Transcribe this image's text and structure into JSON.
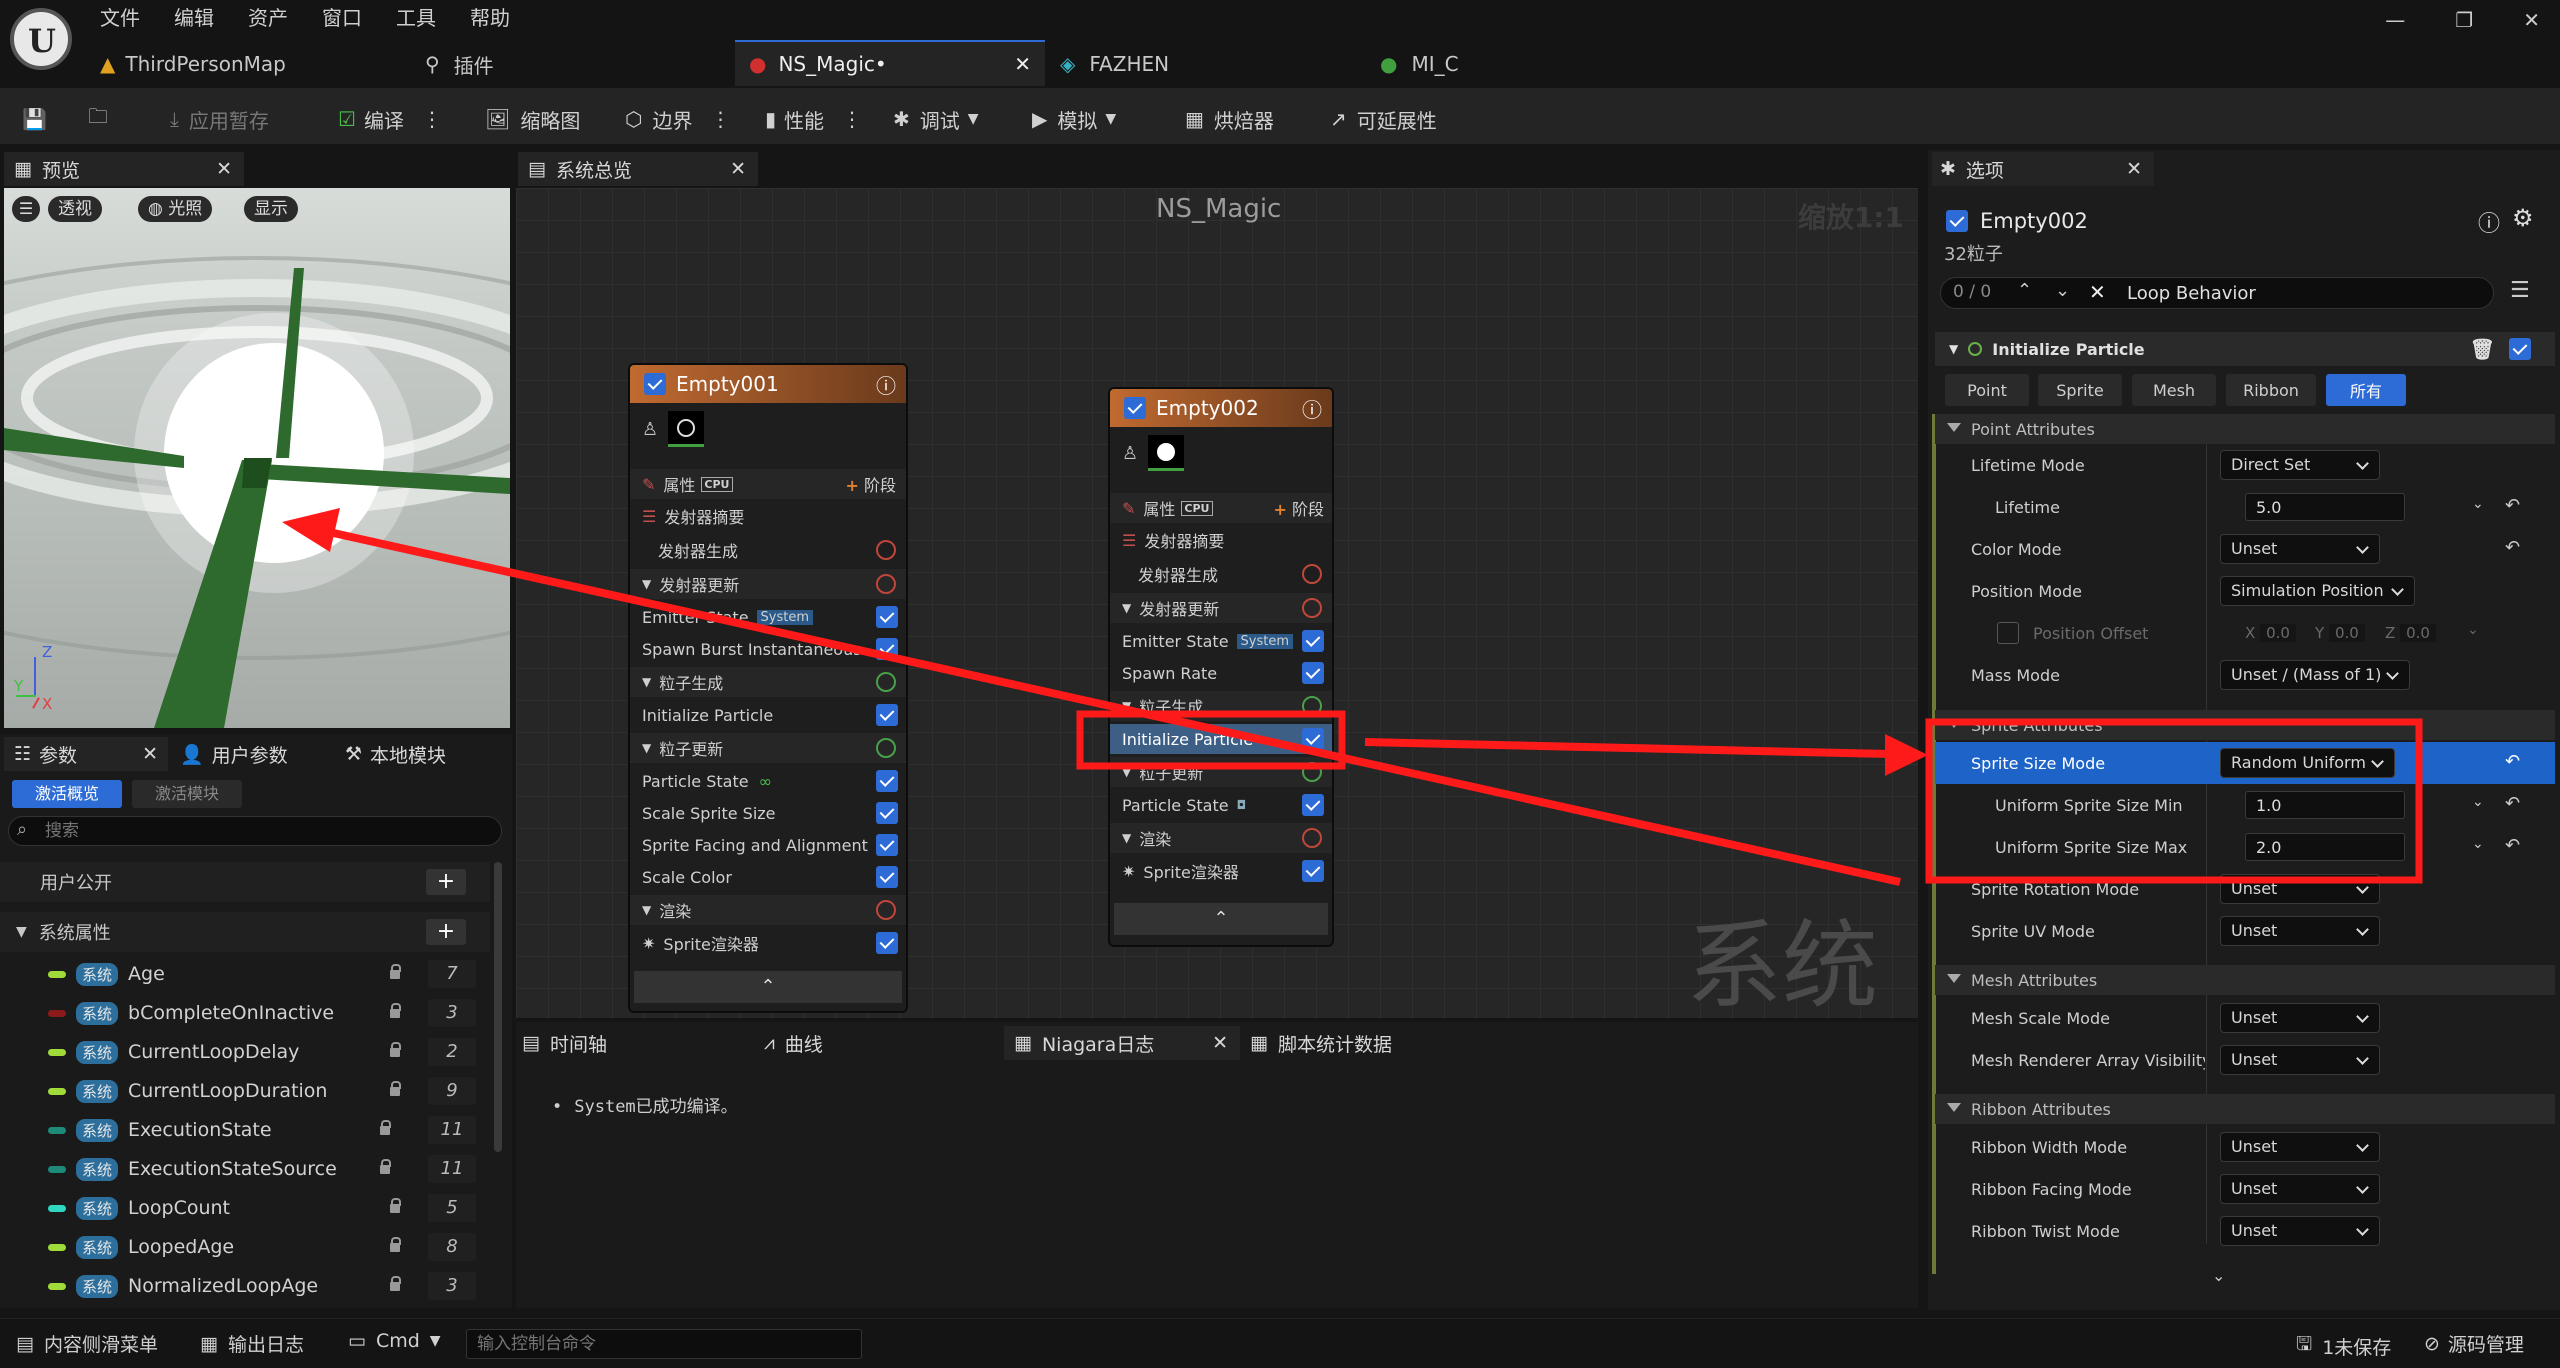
{
  "menu": {
    "items": [
      "文件",
      "编辑",
      "资产",
      "窗口",
      "工具",
      "帮助"
    ]
  },
  "tabs": [
    {
      "label": "ThirdPersonMap"
    },
    {
      "label": "插件"
    },
    {
      "label": "NS_Magic•"
    },
    {
      "label": "FAZHEN"
    },
    {
      "label": "MI_C"
    }
  ],
  "toolbar": {
    "apply_pending": "应用暂存",
    "compile": "编译",
    "thumbnail": "缩略图",
    "bounds": "边界",
    "performance": "性能",
    "debug": "调试",
    "simulate": "模拟",
    "baker": "烘焙器",
    "scalability": "可延展性"
  },
  "preview": {
    "tab": "预览",
    "perspective": "透视",
    "lit": "光照",
    "show": "显示",
    "axis_z": "Z",
    "axis_y": "Y",
    "axis_x": "X"
  },
  "graph": {
    "tab": "系统总览",
    "title": "NS_Magic",
    "zoom": "缩放1:1",
    "watermark": "系统"
  },
  "node1": {
    "title": "Empty001",
    "attr": "属性",
    "cpu": "CPU",
    "stage": "阶段",
    "rows": [
      "发射器摘要",
      "发射器生成",
      "发射器更新",
      "Emitter State",
      "Spawn Burst Instantaneous",
      "粒子生成",
      "Initialize Particle",
      "粒子更新",
      "Particle State",
      "Scale Sprite Size",
      "Sprite Facing and Alignment",
      "Scale Color",
      "渲染",
      "Sprite渲染器"
    ],
    "system_badge": "System"
  },
  "node2": {
    "title": "Empty002",
    "attr": "属性",
    "cpu": "CPU",
    "stage": "阶段",
    "rows": [
      "发射器摘要",
      "发射器生成",
      "发射器更新",
      "Emitter State",
      "Spawn Rate",
      "粒子生成",
      "Initialize Particle",
      "粒子更新",
      "Particle State",
      "渲染",
      "Sprite渲染器"
    ],
    "system_badge": "System"
  },
  "bottom_tabs": {
    "timeline": "时间轴",
    "curves": "曲线",
    "niagara_log": "Niagara日志",
    "script_stats": "脚本统计数据",
    "log_message": "System已成功编译。"
  },
  "params": {
    "tab_params": "参数",
    "tab_user": "用户参数",
    "tab_local": "本地模块",
    "active_overview": "激活概览",
    "active_module": "激活模块",
    "search_placeholder": "搜索",
    "user_exposed": "用户公开",
    "system_attributes": "系统属性",
    "badge": "系统",
    "items": [
      {
        "name": "Age",
        "value": "7",
        "color": "#9fdc3a"
      },
      {
        "name": "bCompleteOnInactive",
        "value": "3",
        "color": "#8c1a1a"
      },
      {
        "name": "CurrentLoopDelay",
        "value": "2",
        "color": "#9fdc3a"
      },
      {
        "name": "CurrentLoopDuration",
        "value": "9",
        "color": "#9fdc3a"
      },
      {
        "name": "ExecutionState",
        "value": "11",
        "color": "#1e8a7a"
      },
      {
        "name": "ExecutionStateSource",
        "value": "11",
        "color": "#1e8a7a"
      },
      {
        "name": "LoopCount",
        "value": "5",
        "color": "#2ed8c0"
      },
      {
        "name": "LoopedAge",
        "value": "8",
        "color": "#9fdc3a"
      },
      {
        "name": "NormalizedLoopAge",
        "value": "3",
        "color": "#9fdc3a"
      }
    ]
  },
  "details": {
    "tab": "选项",
    "emitter": "Empty002",
    "particles": "32粒子",
    "search_count": "0 / 0",
    "search_value": "Loop Behavior",
    "module": "Initialize Particle",
    "filters": [
      "Point",
      "Sprite",
      "Mesh",
      "Ribbon",
      "所有"
    ],
    "sec_point": "Point Attributes",
    "lifetime_mode": {
      "label": "Lifetime Mode",
      "value": "Direct Set"
    },
    "lifetime": {
      "label": "Lifetime",
      "value": "5.0"
    },
    "color_mode": {
      "label": "Color Mode",
      "value": "Unset"
    },
    "position_mode": {
      "label": "Position Mode",
      "value": "Simulation Position"
    },
    "position_offset": {
      "label": "Position Offset",
      "x": "X",
      "xv": "0.0",
      "y": "Y",
      "yv": "0.0",
      "z": "Z",
      "zv": "0.0"
    },
    "mass_mode": {
      "label": "Mass Mode",
      "value": "Unset / (Mass of 1)"
    },
    "sec_sprite": "Sprite Attributes",
    "sprite_size_mode": {
      "label": "Sprite Size Mode",
      "value": "Random Uniform"
    },
    "uniform_min": {
      "label": "Uniform Sprite Size Min",
      "value": "1.0"
    },
    "uniform_max": {
      "label": "Uniform Sprite Size Max",
      "value": "2.0"
    },
    "sprite_rotation_mode": {
      "label": "Sprite Rotation Mode",
      "value": "Unset"
    },
    "sprite_uv_mode": {
      "label": "Sprite UV Mode",
      "value": "Unset"
    },
    "sec_mesh": "Mesh Attributes",
    "mesh_scale_mode": {
      "label": "Mesh Scale Mode",
      "value": "Unset"
    },
    "mesh_vis_mode": {
      "label": "Mesh Renderer Array Visibility M",
      "value": "Unset"
    },
    "sec_ribbon": "Ribbon Attributes",
    "ribbon_width_mode": {
      "label": "Ribbon Width Mode",
      "value": "Unset"
    },
    "ribbon_facing_mode": {
      "label": "Ribbon Facing Mode",
      "value": "Unset"
    },
    "ribbon_twist_mode": {
      "label": "Ribbon Twist Mode",
      "value": "Unset"
    }
  },
  "statusbar": {
    "content_drawer": "内容侧滑菜单",
    "output_log": "输出日志",
    "cmd": "Cmd",
    "console_placeholder": "输入控制台命令",
    "unsaved": "1未保存",
    "source_control": "源码管理"
  }
}
